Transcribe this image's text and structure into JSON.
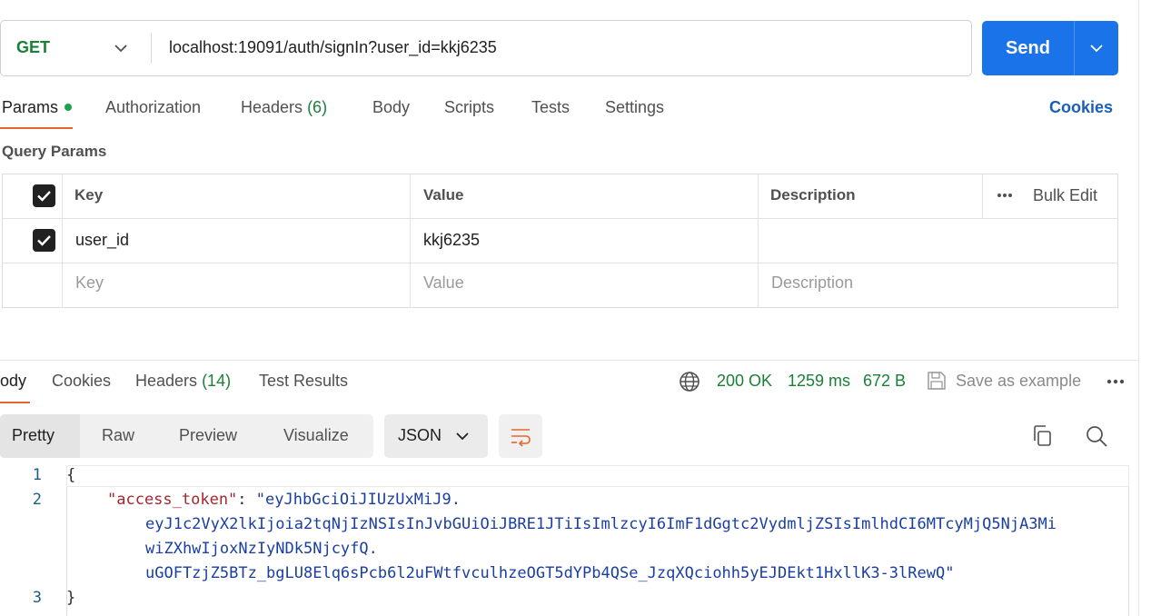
{
  "request": {
    "method": "GET",
    "url": "localhost:19091/auth/signIn?user_id=kkj6235",
    "send_label": "Send"
  },
  "request_tabs": {
    "params": "Params",
    "authorization": "Authorization",
    "headers": "Headers",
    "headers_count": "(6)",
    "body": "Body",
    "scripts": "Scripts",
    "tests": "Tests",
    "settings": "Settings",
    "cookies": "Cookies"
  },
  "query_params": {
    "title": "Query Params",
    "headers": {
      "key": "Key",
      "value": "Value",
      "description": "Description",
      "bulk_edit": "Bulk Edit"
    },
    "rows": [
      {
        "checked": true,
        "key": "user_id",
        "value": "kkj6235",
        "description": ""
      }
    ],
    "placeholders": {
      "key": "Key",
      "value": "Value",
      "description": "Description"
    }
  },
  "response_tabs": {
    "body": "ody",
    "cookies": "Cookies",
    "headers": "Headers",
    "headers_count": "(14)",
    "test_results": "Test Results"
  },
  "response_status": {
    "code": "200 OK",
    "time": "1259 ms",
    "size": "672 B",
    "save_example": "Save as example"
  },
  "view": {
    "modes": [
      "Pretty",
      "Raw",
      "Preview",
      "Visualize"
    ],
    "active": "Pretty",
    "format": "JSON"
  },
  "code": {
    "line_numbers": [
      "1",
      "2",
      "3"
    ],
    "open_brace": "{",
    "close_brace": "}",
    "key": "\"access_token\"",
    "colon": ": ",
    "value_lines": [
      "\"eyJhbGciOiJIUzUxMiJ9.",
      "eyJ1c2VyX2lkIjoia2tqNjIzNSIsInJvbGUiOiJBRE1JTiIsImlzcyI6ImF1dGgtc2VydmljZSIsImlhdCI6MTcyMjQ5NjA3Mi",
      "wiZXhwIjoxNzIyNDk5NjcyfQ.",
      "uGOFTzjZ5BTz_bgLU8Elq6sPcb6l2uFWtfvculhzeOGT5dYPb4QSe_JzqXQciohh5yEJDEkt1HxllK3-3lRewQ\""
    ]
  },
  "colors": {
    "accent": "#1a73e8",
    "tab_underline": "#e8652b",
    "status_green": "#1a7f37"
  }
}
